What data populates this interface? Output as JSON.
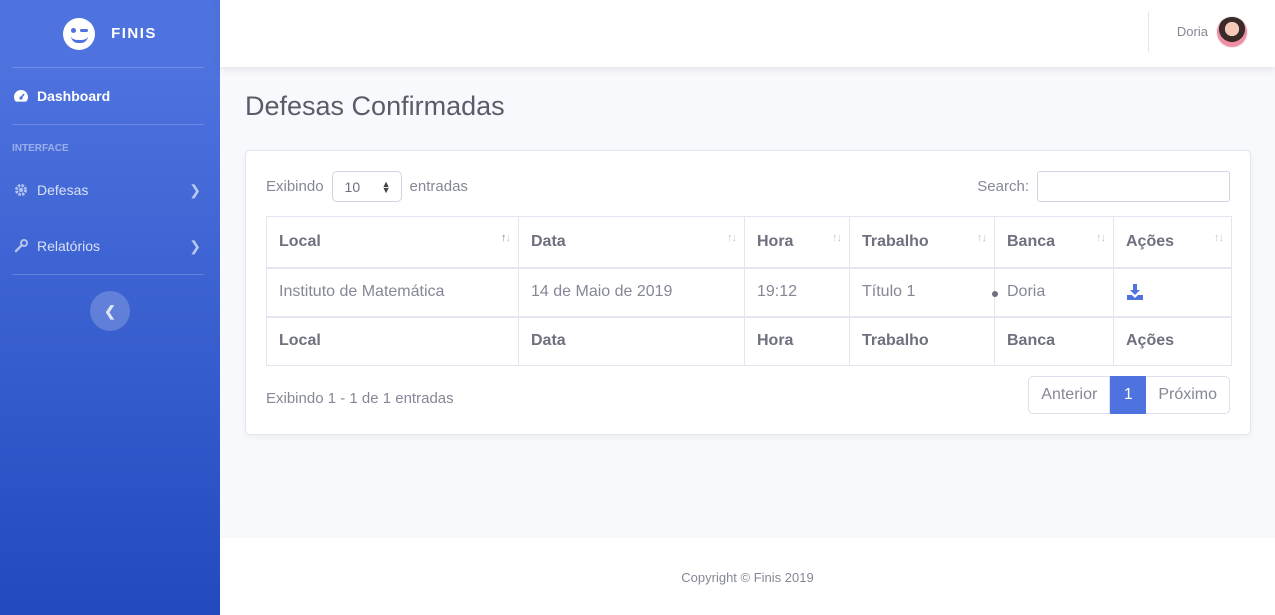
{
  "brand": {
    "name": "FINIS",
    "icon": "winking-face-icon"
  },
  "sidebar": {
    "dashboard": {
      "label": "Dashboard",
      "icon": "tachometer-icon"
    },
    "heading": "INTERFACE",
    "items": [
      {
        "label": "Defesas",
        "icon": "cog-icon"
      },
      {
        "label": "Relatórios",
        "icon": "wrench-icon"
      }
    ],
    "toggle_icon": "chevron-left-icon"
  },
  "topbar": {
    "user_name": "Doria"
  },
  "page": {
    "title": "Defesas Confirmadas"
  },
  "table_controls": {
    "length_prefix": "Exibindo",
    "length_value": "10",
    "length_suffix": "entradas",
    "search_label": "Search:",
    "search_value": ""
  },
  "table": {
    "columns": [
      "Local",
      "Data",
      "Hora",
      "Trabalho",
      "Banca",
      "Ações"
    ],
    "rows": [
      {
        "local": "Instituto de Matemática",
        "data": "14 de Maio de 2019",
        "hora": "19:12",
        "trabalho": "Título 1",
        "banca": "Doria",
        "acao_icon": "download-icon"
      }
    ]
  },
  "footer_info": "Exibindo 1 - 1 de 1 entradas",
  "pagination": {
    "prev": "Anterior",
    "current": "1",
    "next": "Próximo"
  },
  "footer": {
    "copyright": "Copyright © Finis 2019"
  },
  "colors": {
    "primary": "#4e73df",
    "sidebar_end": "#224abe",
    "text": "#858796",
    "heading": "#5a5c69"
  }
}
